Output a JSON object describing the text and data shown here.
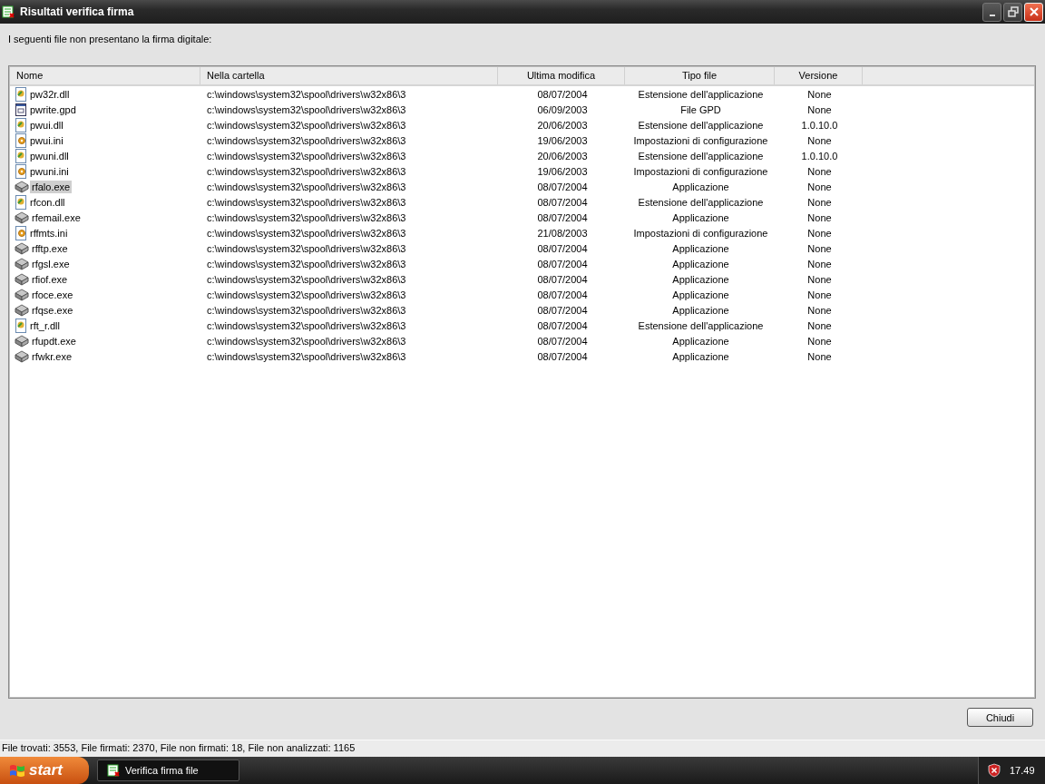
{
  "window": {
    "title": "Risultati verifica firma"
  },
  "message": "I seguenti file non presentano la firma digitale:",
  "table": {
    "columns": [
      "Nome",
      "Nella cartella",
      "Ultima modifica",
      "Tipo file",
      "Versione"
    ],
    "rows": [
      {
        "kind": "dll",
        "name": "pw32r.dll",
        "folder": "c:\\windows\\system32\\spool\\drivers\\w32x86\\3",
        "modified": "08/07/2004",
        "type": "Estensione dell'applicazione",
        "version": "None",
        "selected": false
      },
      {
        "kind": "gpd",
        "name": "pwrite.gpd",
        "folder": "c:\\windows\\system32\\spool\\drivers\\w32x86\\3",
        "modified": "06/09/2003",
        "type": "File GPD",
        "version": "None",
        "selected": false
      },
      {
        "kind": "dll",
        "name": "pwui.dll",
        "folder": "c:\\windows\\system32\\spool\\drivers\\w32x86\\3",
        "modified": "20/06/2003",
        "type": "Estensione dell'applicazione",
        "version": "1.0.10.0",
        "selected": false
      },
      {
        "kind": "ini",
        "name": "pwui.ini",
        "folder": "c:\\windows\\system32\\spool\\drivers\\w32x86\\3",
        "modified": "19/06/2003",
        "type": "Impostazioni di configurazione",
        "version": "None",
        "selected": false
      },
      {
        "kind": "dll",
        "name": "pwuni.dll",
        "folder": "c:\\windows\\system32\\spool\\drivers\\w32x86\\3",
        "modified": "20/06/2003",
        "type": "Estensione dell'applicazione",
        "version": "1.0.10.0",
        "selected": false
      },
      {
        "kind": "ini",
        "name": "pwuni.ini",
        "folder": "c:\\windows\\system32\\spool\\drivers\\w32x86\\3",
        "modified": "19/06/2003",
        "type": "Impostazioni di configurazione",
        "version": "None",
        "selected": false
      },
      {
        "kind": "exe",
        "name": "rfalo.exe",
        "folder": "c:\\windows\\system32\\spool\\drivers\\w32x86\\3",
        "modified": "08/07/2004",
        "type": "Applicazione",
        "version": "None",
        "selected": true
      },
      {
        "kind": "dll",
        "name": "rfcon.dll",
        "folder": "c:\\windows\\system32\\spool\\drivers\\w32x86\\3",
        "modified": "08/07/2004",
        "type": "Estensione dell'applicazione",
        "version": "None",
        "selected": false
      },
      {
        "kind": "exe",
        "name": "rfemail.exe",
        "folder": "c:\\windows\\system32\\spool\\drivers\\w32x86\\3",
        "modified": "08/07/2004",
        "type": "Applicazione",
        "version": "None",
        "selected": false
      },
      {
        "kind": "ini",
        "name": "rffmts.ini",
        "folder": "c:\\windows\\system32\\spool\\drivers\\w32x86\\3",
        "modified": "21/08/2003",
        "type": "Impostazioni di configurazione",
        "version": "None",
        "selected": false
      },
      {
        "kind": "exe",
        "name": "rfftp.exe",
        "folder": "c:\\windows\\system32\\spool\\drivers\\w32x86\\3",
        "modified": "08/07/2004",
        "type": "Applicazione",
        "version": "None",
        "selected": false
      },
      {
        "kind": "exe",
        "name": "rfgsl.exe",
        "folder": "c:\\windows\\system32\\spool\\drivers\\w32x86\\3",
        "modified": "08/07/2004",
        "type": "Applicazione",
        "version": "None",
        "selected": false
      },
      {
        "kind": "exe",
        "name": "rfiof.exe",
        "folder": "c:\\windows\\system32\\spool\\drivers\\w32x86\\3",
        "modified": "08/07/2004",
        "type": "Applicazione",
        "version": "None",
        "selected": false
      },
      {
        "kind": "exe",
        "name": "rfoce.exe",
        "folder": "c:\\windows\\system32\\spool\\drivers\\w32x86\\3",
        "modified": "08/07/2004",
        "type": "Applicazione",
        "version": "None",
        "selected": false
      },
      {
        "kind": "exe",
        "name": "rfqse.exe",
        "folder": "c:\\windows\\system32\\spool\\drivers\\w32x86\\3",
        "modified": "08/07/2004",
        "type": "Applicazione",
        "version": "None",
        "selected": false
      },
      {
        "kind": "dll",
        "name": "rft_r.dll",
        "folder": "c:\\windows\\system32\\spool\\drivers\\w32x86\\3",
        "modified": "08/07/2004",
        "type": "Estensione dell'applicazione",
        "version": "None",
        "selected": false
      },
      {
        "kind": "exe",
        "name": "rfupdt.exe",
        "folder": "c:\\windows\\system32\\spool\\drivers\\w32x86\\3",
        "modified": "08/07/2004",
        "type": "Applicazione",
        "version": "None",
        "selected": false
      },
      {
        "kind": "exe",
        "name": "rfwkr.exe",
        "folder": "c:\\windows\\system32\\spool\\drivers\\w32x86\\3",
        "modified": "08/07/2004",
        "type": "Applicazione",
        "version": "None",
        "selected": false
      }
    ]
  },
  "buttons": [
    "Chiudi"
  ],
  "status_bar": "File trovati: 3553, File firmati: 2370, File non firmati: 18, File non analizzati: 1165",
  "taskbar": {
    "start": "start",
    "tasks": [
      {
        "label": "Verifica firma file",
        "selected": false
      }
    ],
    "clock": "17.49"
  }
}
